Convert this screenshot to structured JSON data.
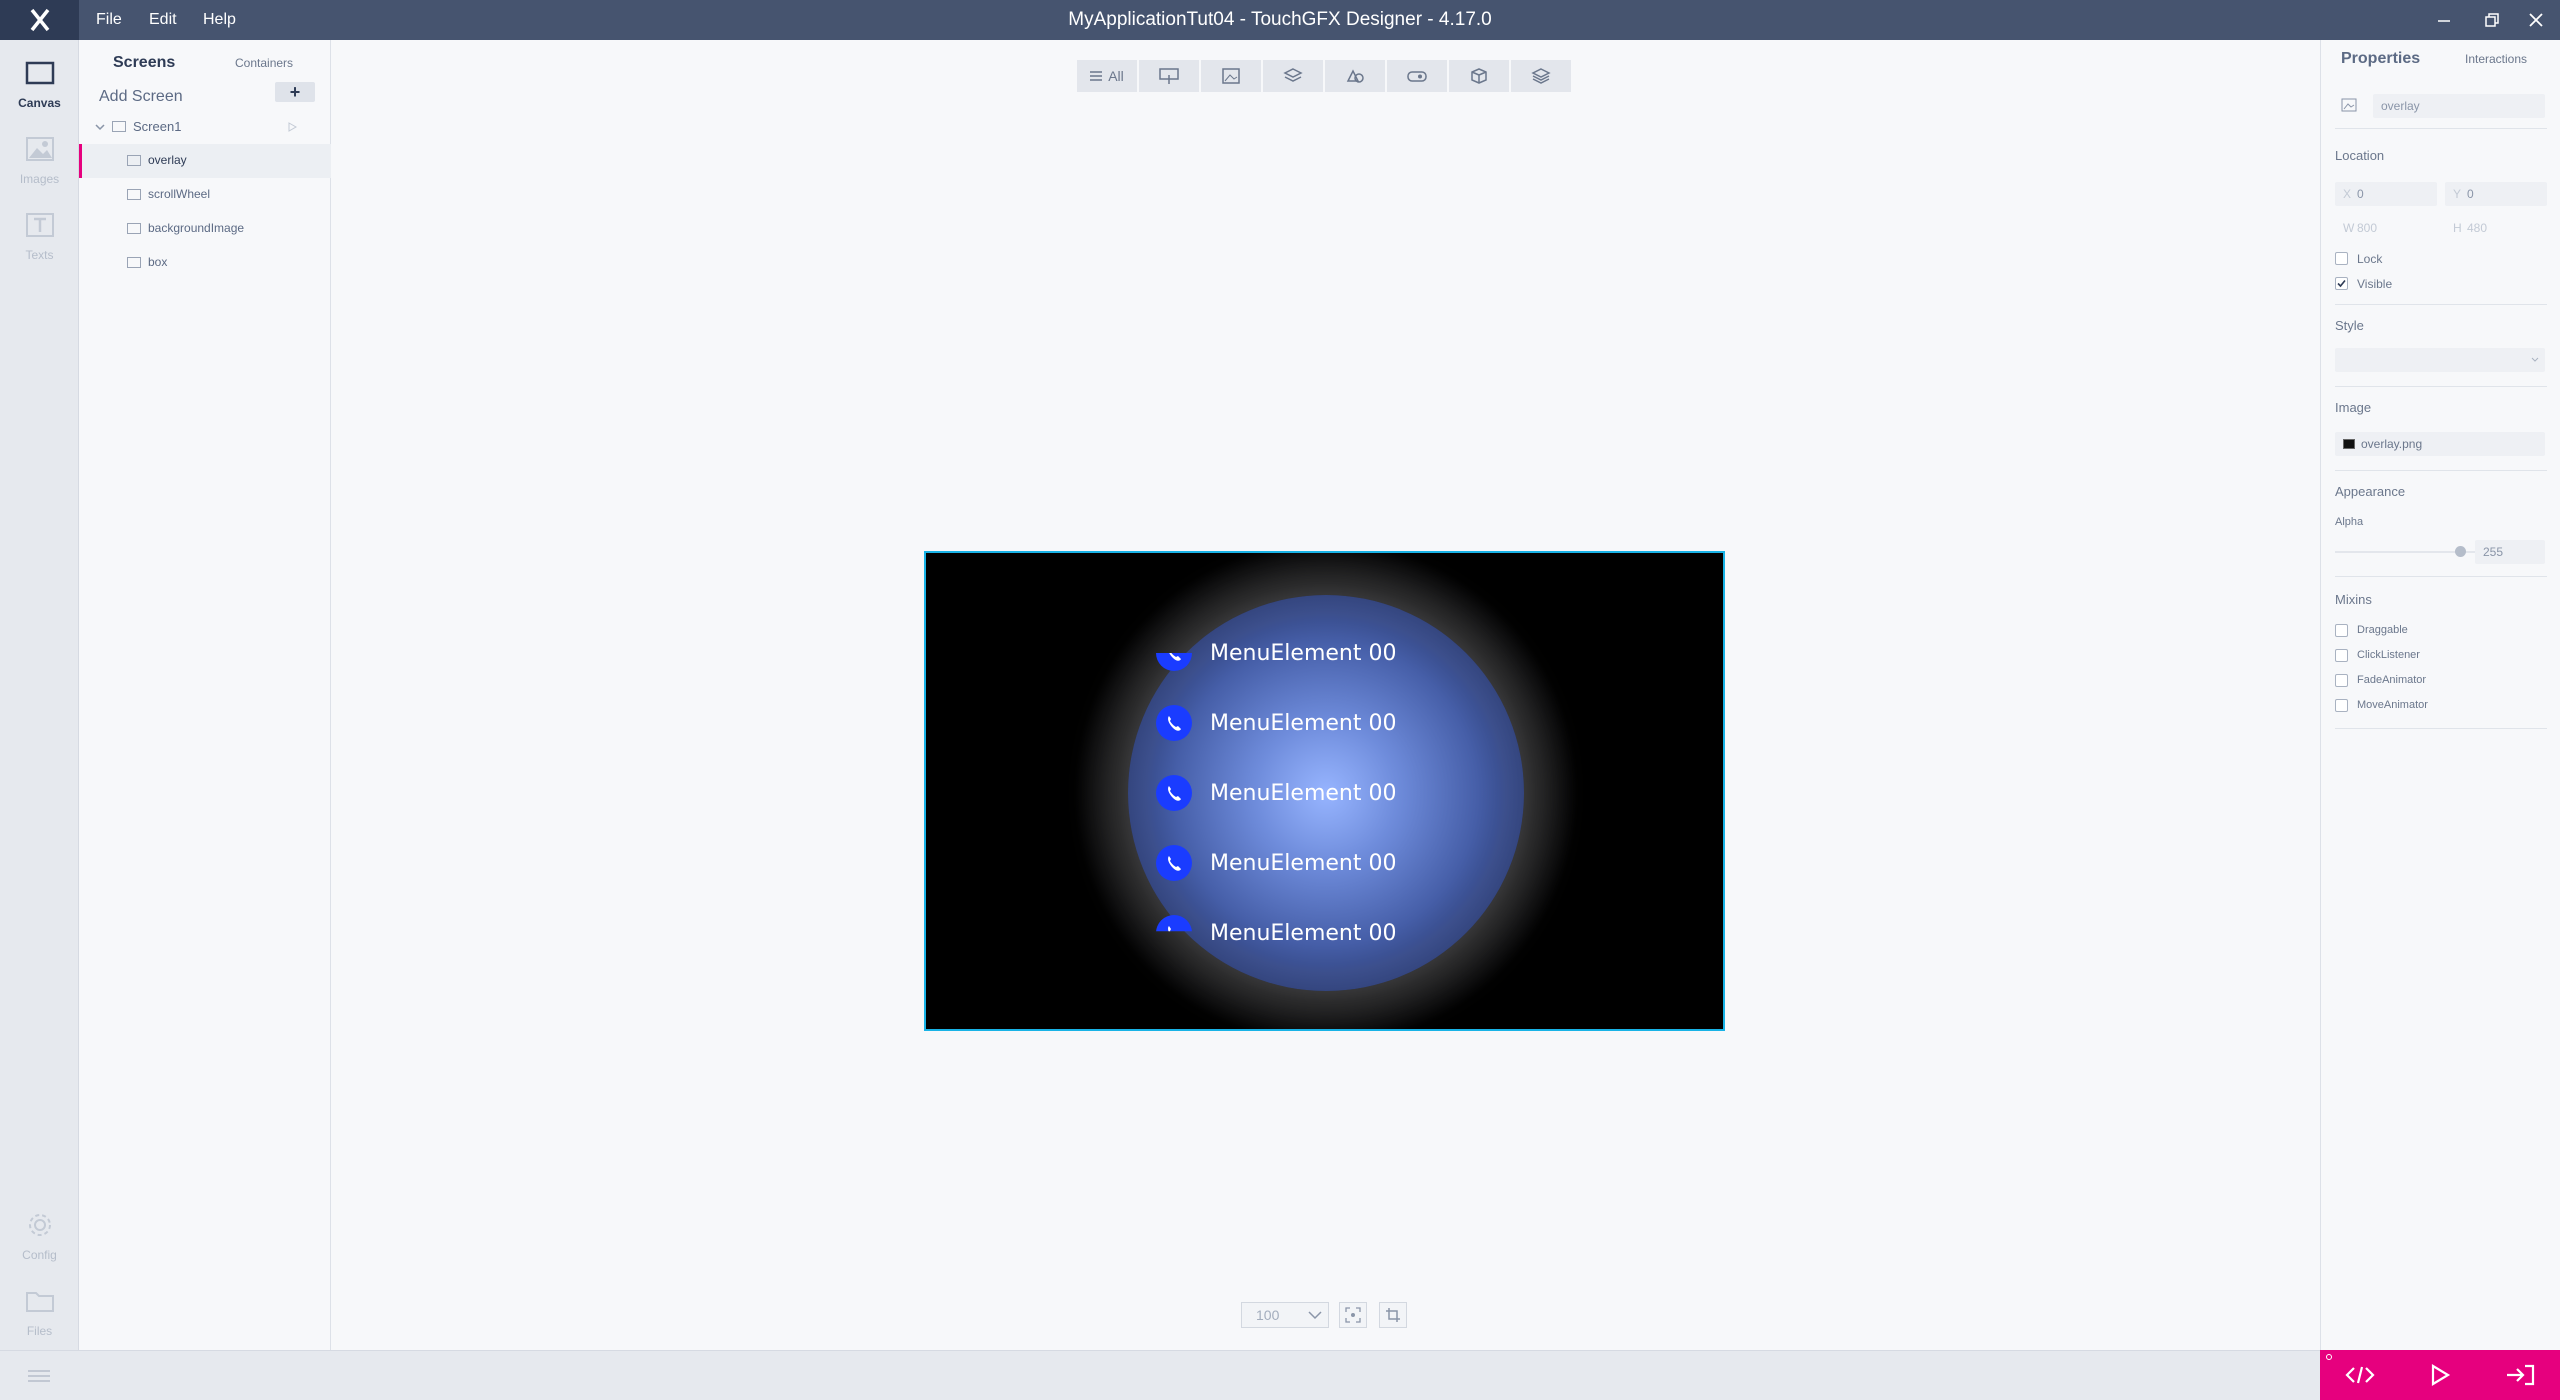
{
  "window": {
    "title": "MyApplicationTut04 - TouchGFX Designer - 4.17.0",
    "menu": [
      "File",
      "Edit",
      "Help"
    ]
  },
  "rail": {
    "items": [
      {
        "label": "Canvas",
        "icon": "canvas-icon",
        "active": true
      },
      {
        "label": "Images",
        "icon": "images-icon"
      },
      {
        "label": "Texts",
        "icon": "texts-icon"
      },
      {
        "label": "Config",
        "icon": "gear-icon"
      },
      {
        "label": "Files",
        "icon": "folder-icon"
      }
    ]
  },
  "screens_panel": {
    "tab_screens": "Screens",
    "tab_containers": "Containers",
    "add_screen": "Add Screen",
    "add_button": "+",
    "screen": "Screen1",
    "widgets": [
      "overlay",
      "scrollWheel",
      "backgroundImage",
      "box"
    ]
  },
  "toolbar": {
    "all_label": "All",
    "buttons": [
      "all",
      "interaction-icon",
      "image-icon",
      "container-icon",
      "shapes-icon",
      "button-icon",
      "3d-icon",
      "layers-icon"
    ]
  },
  "canvas": {
    "menu_items": [
      "MenuElement 00",
      "MenuElement 00",
      "MenuElement 00",
      "MenuElement 00",
      "MenuElement 00"
    ]
  },
  "zoom": {
    "value": "100"
  },
  "properties": {
    "tab_properties": "Properties",
    "tab_interactions": "Interactions",
    "name": "overlay",
    "location_heading": "Location",
    "x_label": "X",
    "x_value": "0",
    "y_label": "Y",
    "y_value": "0",
    "w_label": "W",
    "w_value": "800",
    "h_label": "H",
    "h_value": "480",
    "lock_label": "Lock",
    "visible_label": "Visible",
    "style_heading": "Style",
    "image_heading": "Image",
    "image_value": "overlay.png",
    "appearance_heading": "Appearance",
    "alpha_label": "Alpha",
    "alpha_value": "255",
    "mixins_heading": "Mixins",
    "mixins": [
      "Draggable",
      "ClickListener",
      "FadeAnimator",
      "MoveAnimator"
    ]
  },
  "colors": {
    "accent": "#e6007e",
    "titlebar": "#46546f",
    "selection": "#19b3e6"
  }
}
